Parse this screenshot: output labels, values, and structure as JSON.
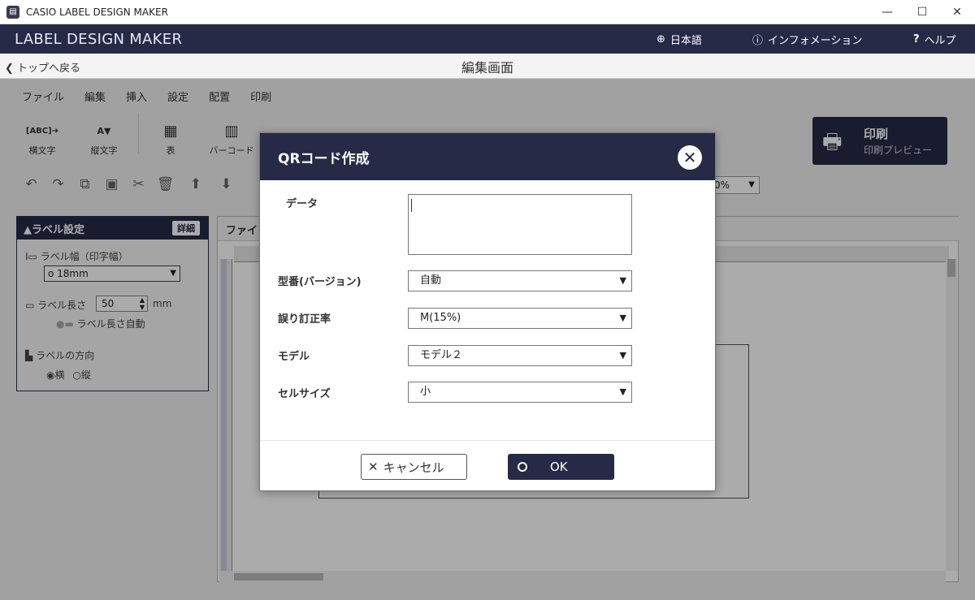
{
  "window": {
    "title": "CASIO LABEL DESIGN MAKER",
    "minimize": "—",
    "maximize": "☐",
    "close": "✕"
  },
  "header": {
    "brand": "LABEL DESIGN MAKER",
    "language": "日本語",
    "info": "インフォメーション",
    "help": "ヘルプ"
  },
  "backbar": {
    "back": "トップへ戻る",
    "screen_title": "編集画面"
  },
  "menus": [
    "ファイル",
    "編集",
    "挿入",
    "設定",
    "配置",
    "印刷"
  ],
  "tools": {
    "horizontal_text": "横文字",
    "vertical_text": "縦文字",
    "table": "表",
    "barcode": "バーコード"
  },
  "print": {
    "label": "印刷",
    "sub": "印刷プレビュー"
  },
  "zoom": "0%",
  "panel": {
    "title": "▲ラベル設定",
    "detail": "詳細",
    "width_label": "ラベル幅（印字幅）",
    "width_value": "o 18mm",
    "length_label": "ラベル長さ",
    "length_value": "50",
    "length_unit": "mm",
    "auto_length": "ラベル長さ自動",
    "direction_label": "ラベルの方向",
    "dir_horizontal": "横",
    "dir_vertical": "縦"
  },
  "canvas": {
    "tab": "ファイ"
  },
  "dialog": {
    "title": "QRコード作成",
    "data_label": "データ",
    "version_label": "型番(バージョン)",
    "version_value": "自動",
    "ecc_label": "誤り訂正率",
    "ecc_value": "M(15%)",
    "model_label": "モデル",
    "model_value": "モデル２",
    "cell_label": "セルサイズ",
    "cell_value": "小",
    "cancel": "キャンセル",
    "ok": "OK"
  },
  "colors": {
    "primary": "#262a47"
  }
}
